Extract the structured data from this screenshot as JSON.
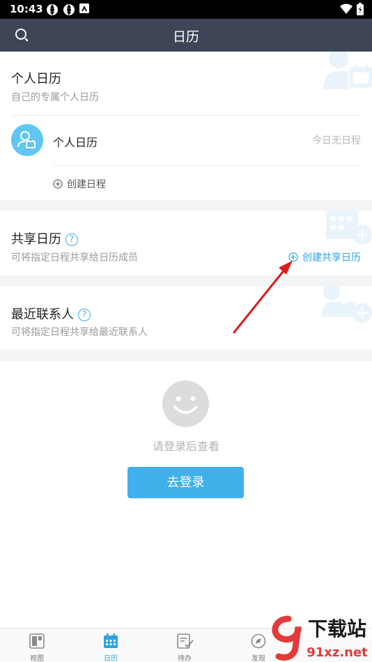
{
  "status_bar": {
    "time": "10:43"
  },
  "header": {
    "title": "日历"
  },
  "personal": {
    "title": "个人日历",
    "subtitle": "自己的专属个人日历",
    "calendar_name": "个人日历",
    "calendar_status": "今日无日程",
    "create_event": "创建日程"
  },
  "shared": {
    "title": "共享日历",
    "help": "?",
    "subtitle": "可将指定日程共享给日历成员",
    "create_shared": "创建共享日历"
  },
  "contacts": {
    "title": "最近联系人",
    "help": "?",
    "subtitle": "可将指定日程共享给最近联系人"
  },
  "login": {
    "hint": "请登录后查看",
    "button": "去登录"
  },
  "tabs": [
    {
      "label": "视图",
      "icon": "view-icon",
      "active": false
    },
    {
      "label": "日历",
      "icon": "calendar-icon",
      "active": true
    },
    {
      "label": "待办",
      "icon": "todo-icon",
      "active": false
    },
    {
      "label": "发现",
      "icon": "discover-icon",
      "active": false
    }
  ],
  "watermark": {
    "brand": "下载站",
    "site": "91xz.net"
  },
  "colors": {
    "accent": "#3fb0ea",
    "header": "#3d4556",
    "annotation_arrow": "#e02424"
  }
}
